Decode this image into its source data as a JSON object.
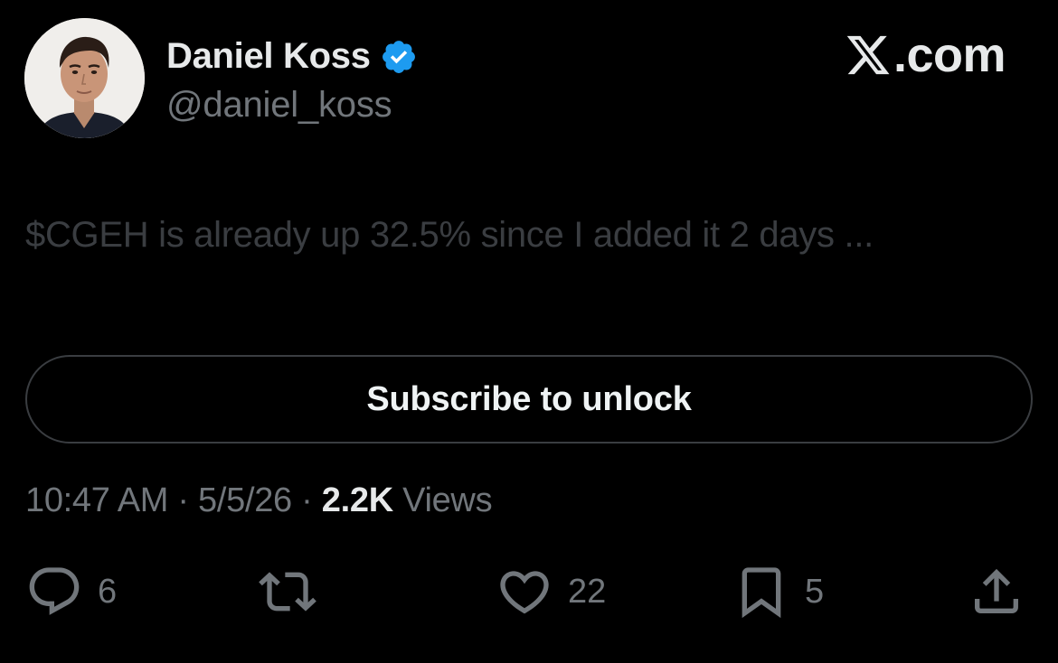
{
  "author": {
    "display_name": "Daniel Koss",
    "handle": "@daniel_koss",
    "verified": true,
    "avatar_icon": "profile-photo"
  },
  "brand": {
    "text": ".com",
    "logo_icon": "x-logo-icon"
  },
  "tweet": {
    "text": "$CGEH is already up 32.5% since I added it 2 days ..."
  },
  "subscribe": {
    "label": "Subscribe to unlock"
  },
  "meta": {
    "time": "10:47 AM",
    "separator": " · ",
    "date": "5/5/26",
    "views_count": "2.2K",
    "views_label": " Views"
  },
  "actions": {
    "reply": {
      "icon": "reply-icon",
      "count": "6"
    },
    "repost": {
      "icon": "repost-icon",
      "count": ""
    },
    "like": {
      "icon": "heart-icon",
      "count": "22"
    },
    "bookmark": {
      "icon": "bookmark-icon",
      "count": "5"
    },
    "share": {
      "icon": "share-icon",
      "count": ""
    }
  },
  "colors": {
    "background": "#000000",
    "primary_text": "#e7e9ea",
    "secondary_text": "#71767b",
    "verified_blue": "#1d9bf0",
    "border": "#3a3d41"
  }
}
